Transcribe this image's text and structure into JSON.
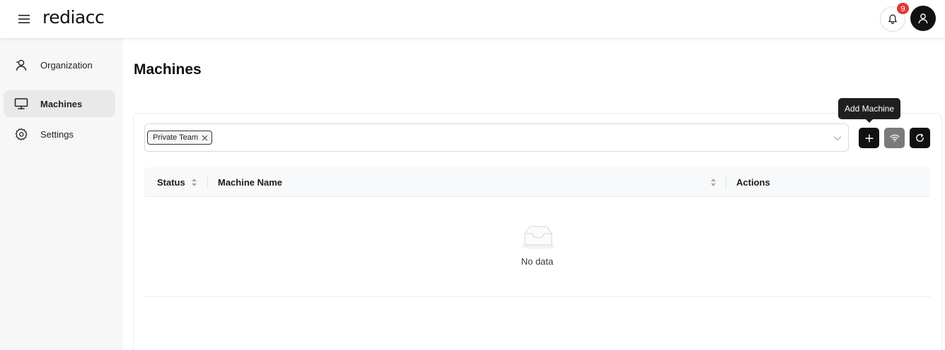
{
  "header": {
    "logo": "rediacc",
    "notifications_count": "9"
  },
  "sidebar": {
    "items": [
      {
        "label": "Organization",
        "icon": "user-icon"
      },
      {
        "label": "Machines",
        "icon": "monitor-icon",
        "active": true
      },
      {
        "label": "Settings",
        "icon": "gear-icon"
      }
    ]
  },
  "main": {
    "title": "Machines",
    "filter": {
      "tag": "Private Team"
    },
    "tooltip": "Add Machine",
    "table": {
      "columns": [
        "Status",
        "Machine Name",
        "Actions"
      ],
      "empty_text": "No data"
    }
  },
  "colors": {
    "accent": "#111111",
    "badge": "#e03a3a",
    "sidebar_bg": "#f7f7f7",
    "active_item_bg": "#e9e9e9"
  }
}
